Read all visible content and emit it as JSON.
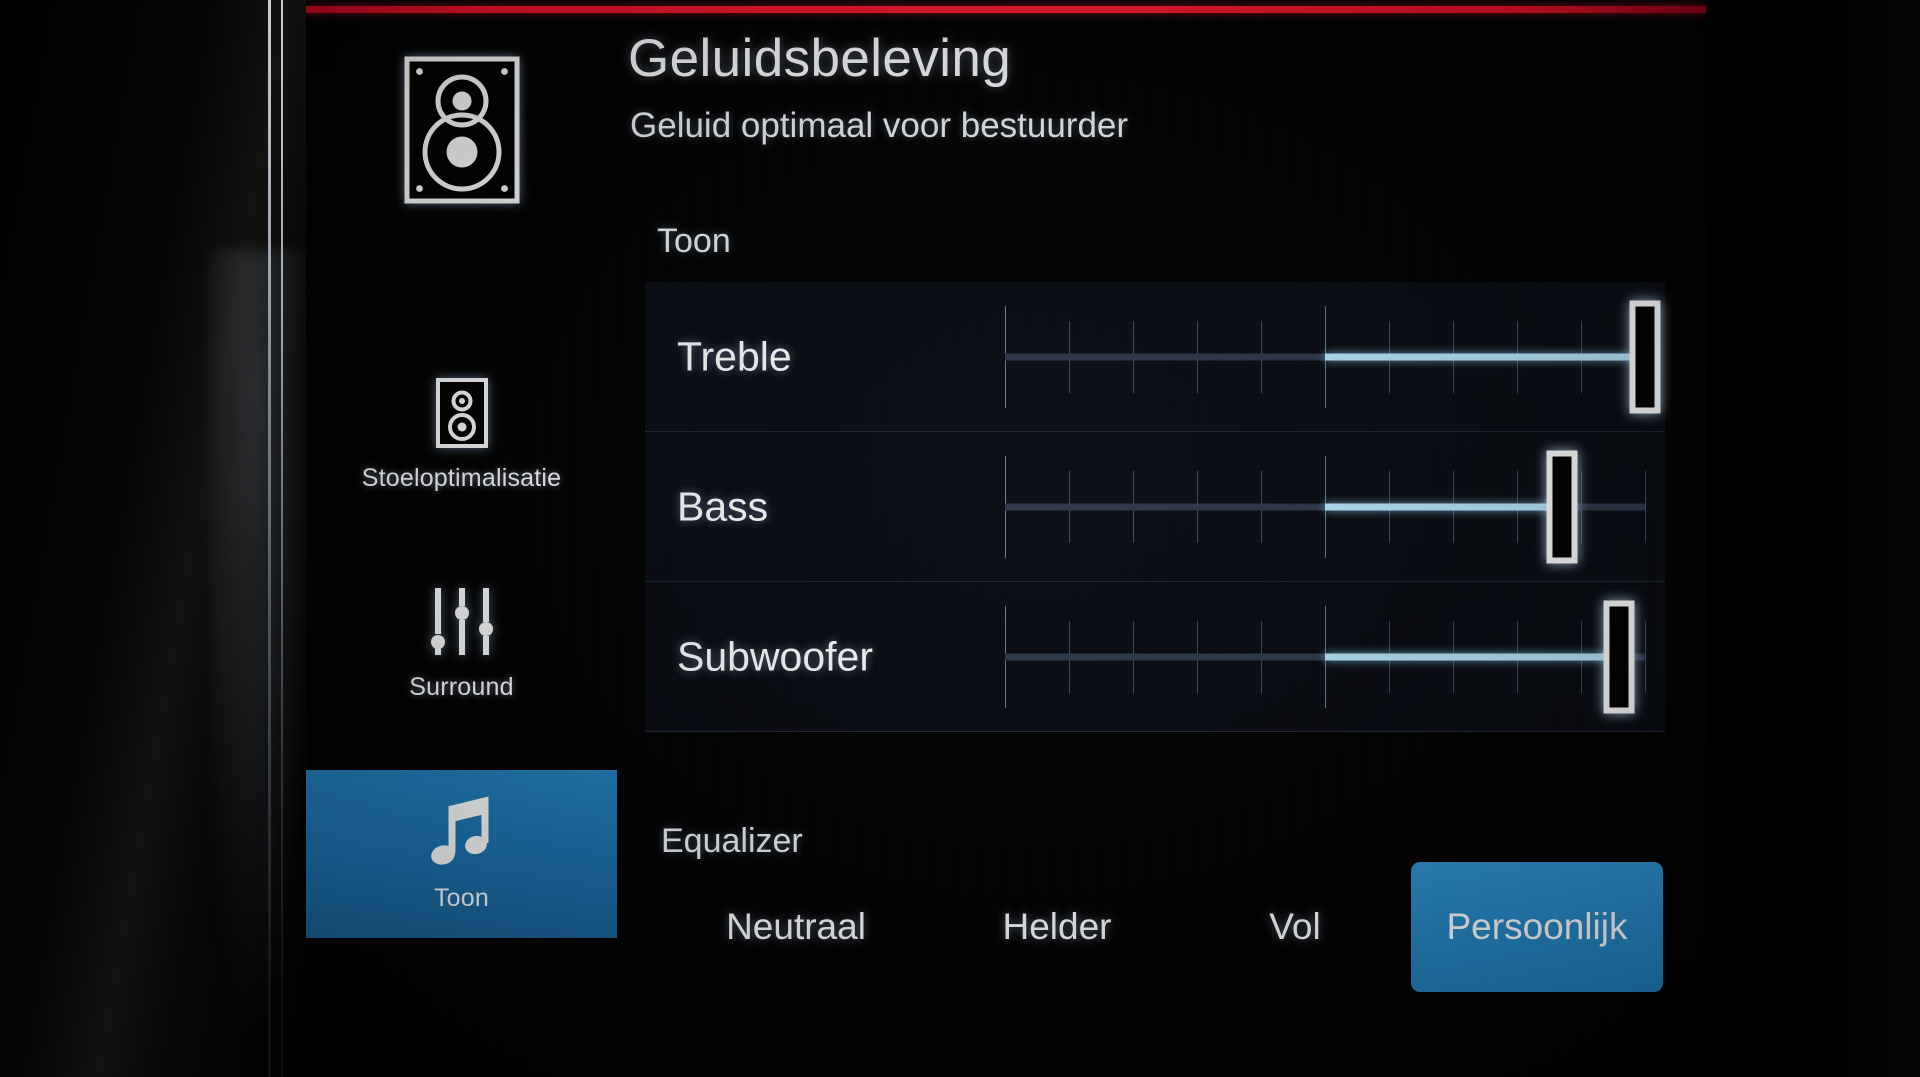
{
  "header": {
    "title": "Geluidsbeleving",
    "subtitle": "Geluid optimaal voor bestuurder"
  },
  "sidebar": {
    "items": [
      {
        "label": "",
        "icon": "speaker-cabinet-icon",
        "selected": false
      },
      {
        "label": "Stoeloptimalisatie",
        "icon": "small-speaker-icon",
        "selected": false
      },
      {
        "label": "Surround",
        "icon": "faders-icon",
        "selected": false
      },
      {
        "label": "Toon",
        "icon": "music-note-icon",
        "selected": true
      }
    ]
  },
  "tone": {
    "section_label": "Toon",
    "sliders": [
      {
        "label": "Treble",
        "value": 100,
        "min": 0,
        "max": 100,
        "fill_from": 50,
        "ticks": 11
      },
      {
        "label": "Bass",
        "value": 87,
        "min": 0,
        "max": 100,
        "fill_from": 50,
        "ticks": 11
      },
      {
        "label": "Subwoofer",
        "value": 96,
        "min": 0,
        "max": 100,
        "fill_from": 50,
        "ticks": 11
      }
    ]
  },
  "equalizer": {
    "section_label": "Equalizer",
    "presets": [
      {
        "label": "Neutraal",
        "selected": false
      },
      {
        "label": "Helder",
        "selected": false
      },
      {
        "label": "Vol",
        "selected": false
      },
      {
        "label": "Persoonlijk",
        "selected": true
      }
    ]
  },
  "colors": {
    "accent_blue": "#2488c8",
    "tile_blue": "#1a74b2",
    "slider_cyan": "#b9e8fb",
    "top_line_red": "#f3102c",
    "track_dim": "#2b374a",
    "panel_bg": "#080b13"
  }
}
